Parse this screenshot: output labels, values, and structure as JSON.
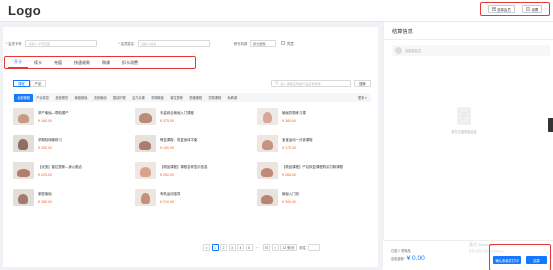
{
  "header": {
    "logo": "Logo",
    "btn_select_member": "选择会员",
    "btn_settings": "设置"
  },
  "form": {
    "member_card_label": "会员卡号",
    "member_card_placeholder": "请输入卡号匹配",
    "name_label": "会员姓名",
    "name_placeholder": "请输入姓名",
    "points_label": "积分扣减",
    "points_value": "积分抵现",
    "checkbox_label": "同意"
  },
  "tabs": [
    {
      "label": "开卡"
    },
    {
      "label": "续卡"
    },
    {
      "label": "充值"
    },
    {
      "label": "快速收款"
    },
    {
      "label": "购课"
    },
    {
      "label": "扣卡消费"
    }
  ],
  "subrow": {
    "segments": [
      "课程",
      "产品"
    ],
    "search_placeholder": "输入课程名称或产品名称搜索",
    "search_button": "搜索"
  },
  "categories": [
    "全部课程",
    "产后恢复",
    "瘦身塑形",
    "瑜伽基础",
    "流竞瑜伽",
    "婴幼护理",
    "活力对课",
    "孕期瑜伽",
    "普拉提斯",
    "舒缓课程",
    "冥想课程",
    "私教课",
    "更多"
  ],
  "products": [
    {
      "name": "孕产瑜伽—帮助顺产",
      "price": "¥ 180.00"
    },
    {
      "name": "天姿综合瑜伽入门课程",
      "price": "¥ 375.00"
    },
    {
      "name": "瑜伽冥想练习课",
      "price": "¥ 385.00"
    },
    {
      "name": "孕期轻体脆练习",
      "price": "¥ 150.00"
    },
    {
      "name": "骨盆课程，恢复身体平衡",
      "price": "¥ 150.00"
    },
    {
      "name": "宝宝运动一分钟课程",
      "price": "¥ 175.00"
    },
    {
      "name": "【优惠】普拉提斯—身心融合",
      "price": "¥ 225.00"
    },
    {
      "name": "【精品课程】课程名称显示信息",
      "price": "¥ 250.00"
    },
    {
      "name": "【精品课程】产后恢复课程购买付款课程",
      "price": "¥ 268.00"
    },
    {
      "name": "家庭瑜伽",
      "price": "¥ 285.00"
    },
    {
      "name": "有氧运动指导",
      "price": "¥ 210.00"
    },
    {
      "name": "瑜伽入门班",
      "price": "¥ 300.00"
    }
  ],
  "pagination": {
    "prev": "<",
    "pages": [
      "1",
      "2",
      "3",
      "4",
      "5"
    ],
    "ellipsis": "···",
    "last": "76",
    "next": ">",
    "page_size": "12 条/页",
    "goto_label": "前往"
  },
  "right": {
    "title": "结算信息",
    "member_hint": "请选择会员",
    "empty_text": "暂无已选商品信息"
  },
  "summary": {
    "count_prefix": "已选",
    "count": "0",
    "count_suffix": "项商品",
    "amount_label": "应收金额:",
    "amount": "¥ 0.00",
    "watermark": "激活 Windows",
    "watermark_sub": "转到“设置”以激活 Windows。",
    "btn_pay": "确认收款并打印",
    "btn_checkout": "结算"
  },
  "colors": {
    "accent": "#1677ff",
    "price": "#f5622d",
    "highlight": "#e53935"
  }
}
